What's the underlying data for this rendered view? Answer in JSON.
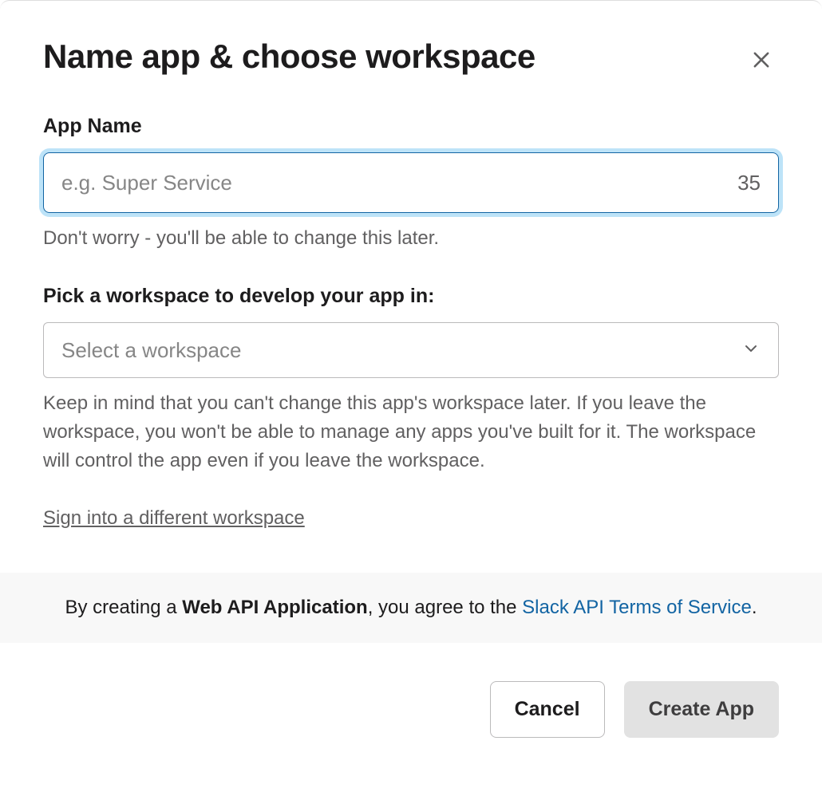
{
  "modal": {
    "title": "Name app & choose workspace",
    "appName": {
      "label": "App Name",
      "placeholder": "e.g. Super Service",
      "value": "",
      "charCount": "35",
      "helpText": "Don't worry - you'll be able to change this later."
    },
    "workspace": {
      "label": "Pick a workspace to develop your app in:",
      "placeholder": "Select a workspace",
      "helpText": "Keep in mind that you can't change this app's workspace later. If you leave the workspace, you won't be able to manage any apps you've built for it. The workspace will control the app even if you leave the workspace."
    },
    "signinLink": "Sign into a different workspace",
    "terms": {
      "prefix": "By creating a ",
      "bold": "Web API Application",
      "middle": ", you agree to the ",
      "linkText": "Slack API Terms of Service",
      "suffix": "."
    },
    "buttons": {
      "cancel": "Cancel",
      "create": "Create App"
    }
  }
}
